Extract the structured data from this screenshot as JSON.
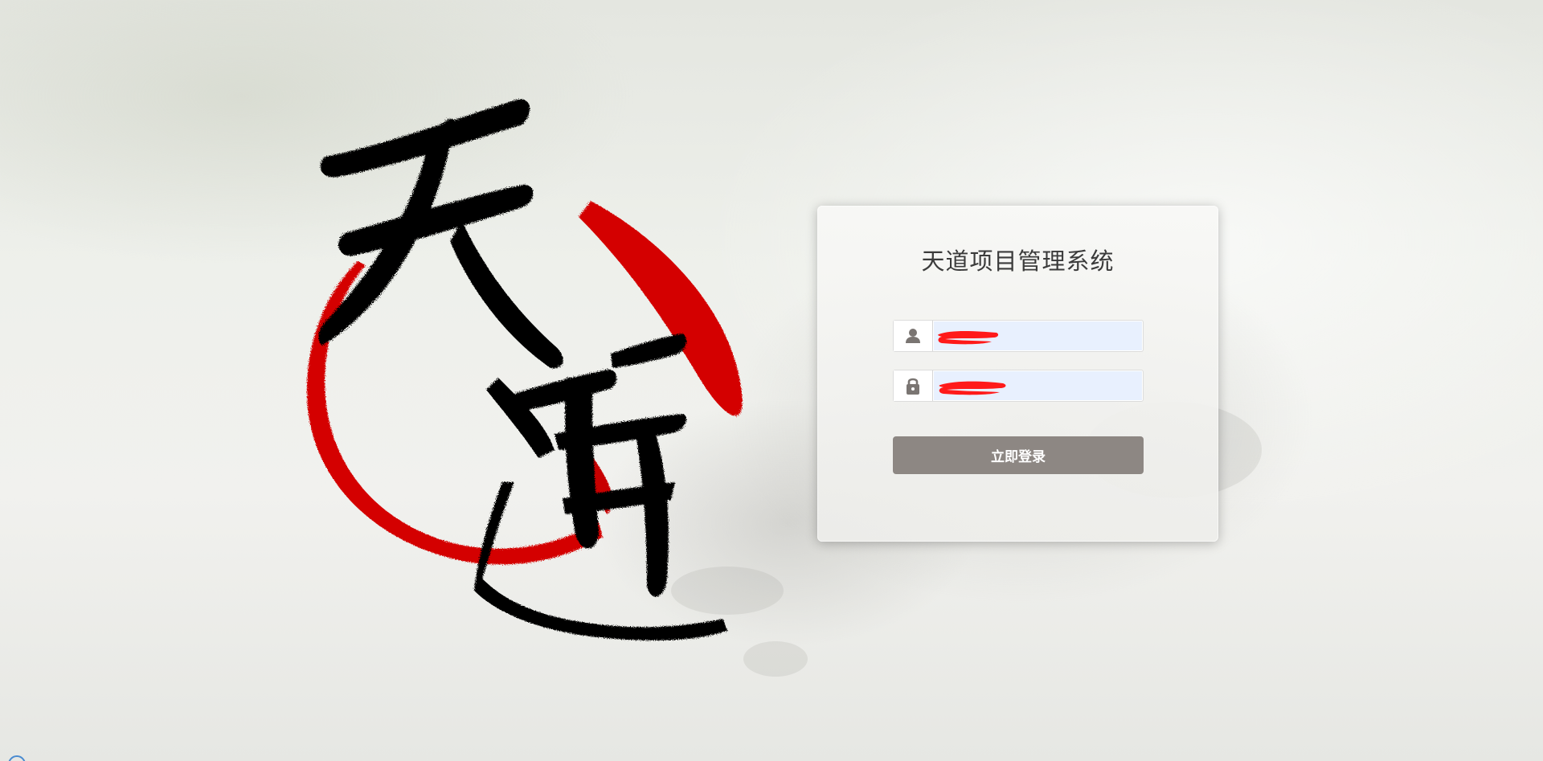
{
  "page": {
    "logo_calligraphy": "天道",
    "colors": {
      "ink": "#050505",
      "brush_red": "#d40000",
      "button_bg": "#8d8783",
      "autofill_bg": "#e8f0fe"
    }
  },
  "login": {
    "title": "天道项目管理系统",
    "username": {
      "icon": "user-icon",
      "value": "",
      "redacted": true
    },
    "password": {
      "icon": "lock-icon",
      "value": "",
      "redacted": true
    },
    "submit_label": "立即登录"
  }
}
